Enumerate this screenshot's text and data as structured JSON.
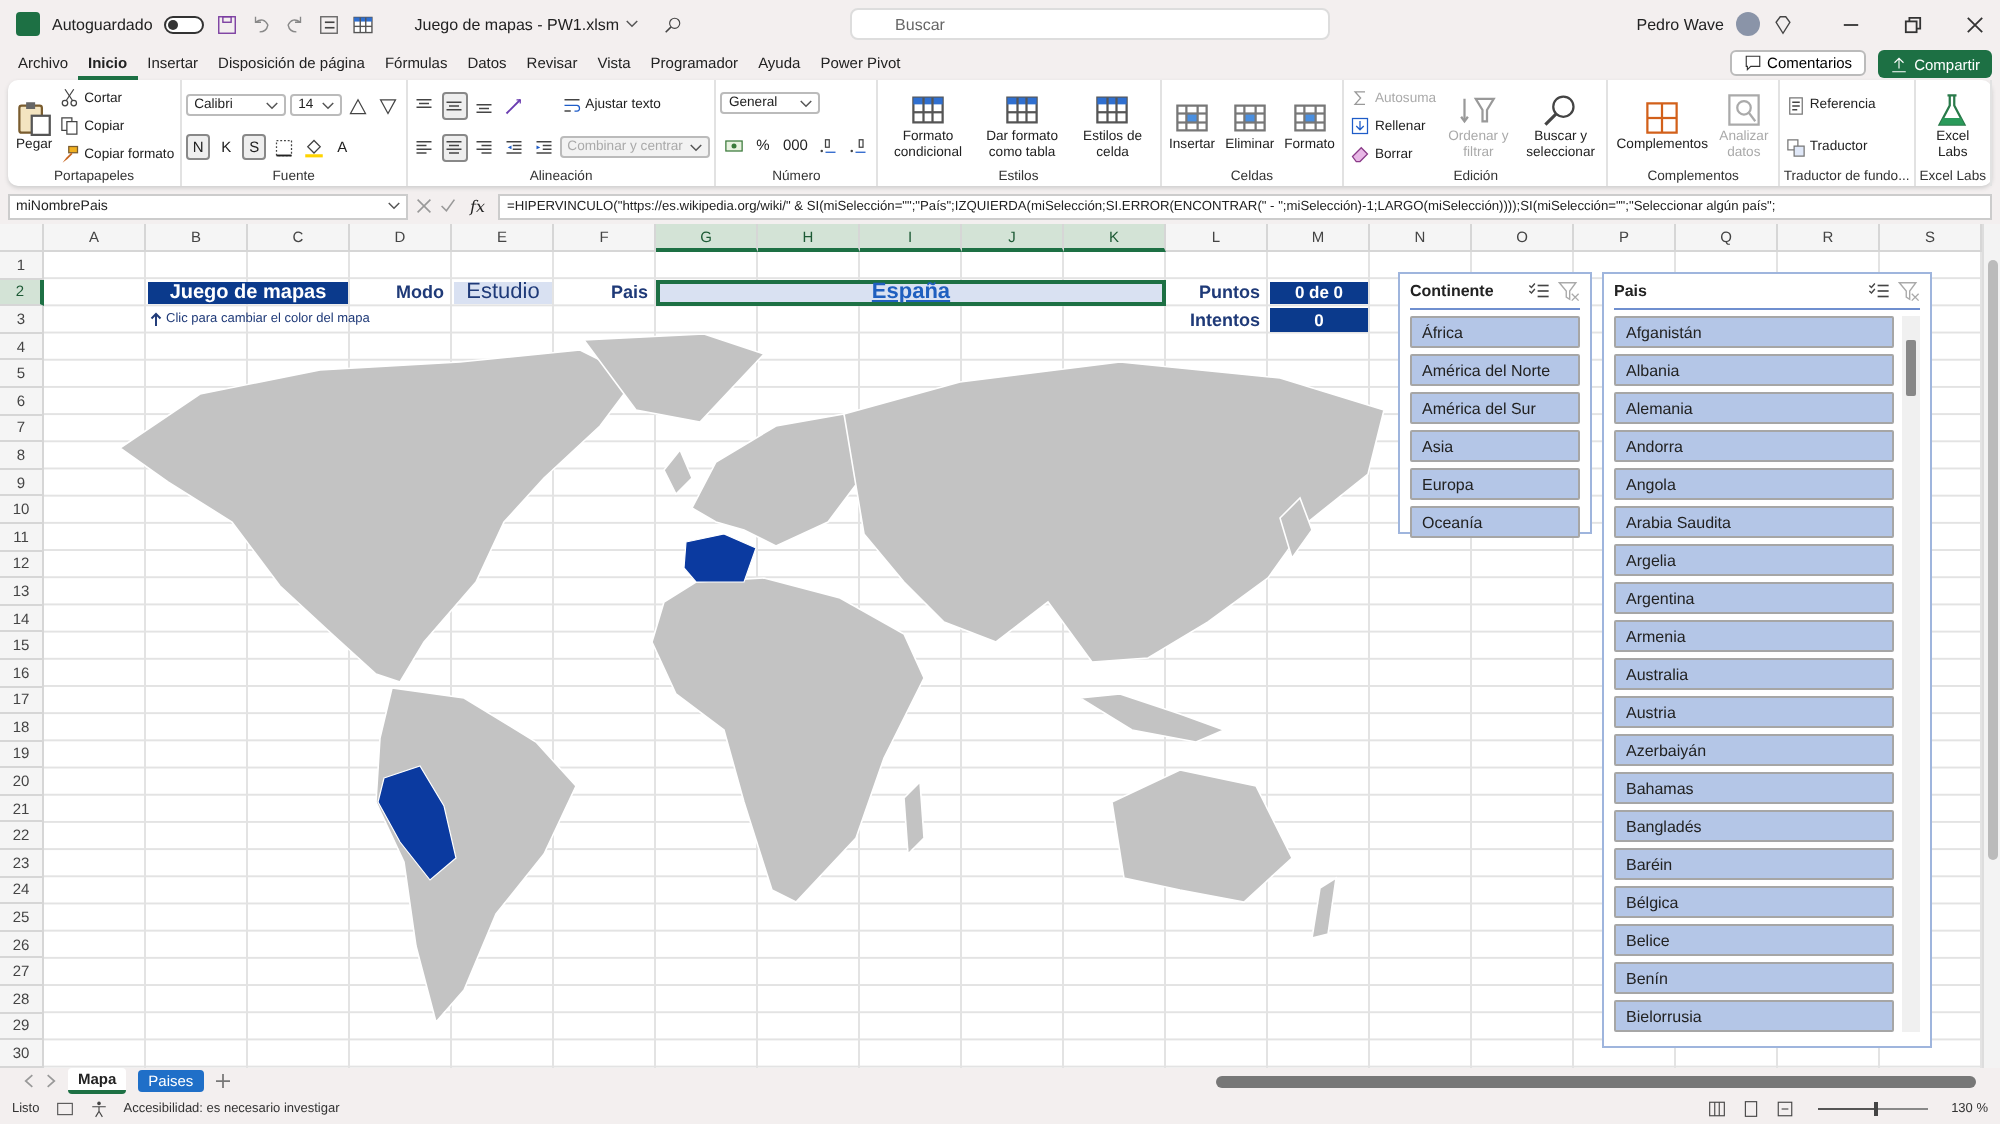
{
  "window": {
    "title": "Juego de mapas - PW1.xlsm",
    "search_placeholder": "Buscar",
    "user": "Pedro Wave"
  },
  "autosave": {
    "label": "Autoguardado",
    "on": false
  },
  "ribbon_tabs": [
    {
      "label": "Archivo",
      "selected": false
    },
    {
      "label": "Inicio",
      "selected": true
    },
    {
      "label": "Insertar",
      "selected": false
    },
    {
      "label": "Disposición de página",
      "selected": false
    },
    {
      "label": "Fórmulas",
      "selected": false
    },
    {
      "label": "Datos",
      "selected": false
    },
    {
      "label": "Revisar",
      "selected": false
    },
    {
      "label": "Vista",
      "selected": false
    },
    {
      "label": "Programador",
      "selected": false
    },
    {
      "label": "Ayuda",
      "selected": false
    },
    {
      "label": "Power Pivot",
      "selected": false
    }
  ],
  "header_buttons": {
    "comments": "Comentarios",
    "share": "Compartir"
  },
  "ribbon_groups": [
    {
      "label": "Portapapeles",
      "columns": [
        [
          [
            {
              "kind": "large",
              "label": "Pegar",
              "disabled": false
            }
          ]
        ],
        [
          [
            {
              "kind": "small",
              "label": "Cortar",
              "disabled": false
            }
          ],
          [
            {
              "kind": "small",
              "label": "Copiar",
              "disabled": false
            }
          ],
          [
            {
              "kind": "small",
              "label": "Copiar formato",
              "disabled": false
            }
          ]
        ]
      ]
    },
    {
      "label": "Fuente",
      "columns": [
        [
          [
            {
              "kind": "combo",
              "label": "Calibri",
              "disabled": false
            },
            {
              "kind": "combo",
              "label": "14",
              "disabled": false
            },
            {
              "kind": "icon",
              "on": false
            },
            {
              "kind": "icon",
              "on": false
            }
          ],
          [
            {
              "kind": "glyph",
              "label": "N",
              "on": true
            },
            {
              "kind": "glyph",
              "label": "K",
              "on": false
            },
            {
              "kind": "glyph",
              "label": "S",
              "on": true
            },
            {
              "kind": "icon",
              "on": false
            },
            {
              "kind": "icon",
              "on": false
            },
            {
              "kind": "glyph",
              "label": "A",
              "on": false
            }
          ]
        ]
      ]
    },
    {
      "label": "Alineación",
      "columns": [
        [
          [
            {
              "kind": "icon",
              "on": false
            },
            {
              "kind": "icon",
              "on": true
            },
            {
              "kind": "icon",
              "on": false
            },
            {
              "kind": "icon",
              "on": false
            }
          ],
          [
            {
              "kind": "icon",
              "on": false
            },
            {
              "kind": "icon",
              "on": true
            },
            {
              "kind": "icon",
              "on": false
            },
            {
              "kind": "icon",
              "on": false
            },
            {
              "kind": "icon",
              "on": false
            }
          ]
        ],
        [
          [
            {
              "kind": "small",
              "label": "Ajustar texto",
              "disabled": false
            }
          ],
          [
            {
              "kind": "combo",
              "label": "Combinar y centrar",
              "disabled": true
            }
          ]
        ]
      ]
    },
    {
      "label": "Número",
      "columns": [
        [
          [
            {
              "kind": "combo",
              "label": "General",
              "disabled": false
            }
          ],
          [
            {
              "kind": "icon",
              "on": false
            },
            {
              "kind": "glyph",
              "label": "%",
              "on": false
            },
            {
              "kind": "glyph",
              "label": "000",
              "on": false
            },
            {
              "kind": "icon",
              "on": false
            },
            {
              "kind": "icon",
              "on": false
            }
          ]
        ]
      ]
    },
    {
      "label": "Estilos",
      "columns": [
        [
          [
            {
              "kind": "large",
              "label": "Formato condicional",
              "disabled": false
            }
          ]
        ],
        [
          [
            {
              "kind": "large",
              "label": "Dar formato como tabla",
              "disabled": false
            }
          ]
        ],
        [
          [
            {
              "kind": "large",
              "label": "Estilos de celda",
              "disabled": false
            }
          ]
        ]
      ]
    },
    {
      "label": "Celdas",
      "columns": [
        [
          [
            {
              "kind": "large",
              "label": "Insertar",
              "disabled": false
            }
          ]
        ],
        [
          [
            {
              "kind": "large",
              "label": "Eliminar",
              "disabled": false
            }
          ]
        ],
        [
          [
            {
              "kind": "large",
              "label": "Formato",
              "disabled": false
            }
          ]
        ]
      ]
    },
    {
      "label": "Edición",
      "columns": [
        [
          [
            {
              "kind": "small",
              "label": "Autosuma",
              "disabled": true
            }
          ],
          [
            {
              "kind": "small",
              "label": "Rellenar",
              "disabled": false
            }
          ],
          [
            {
              "kind": "small",
              "label": "Borrar",
              "disabled": false
            }
          ]
        ],
        [
          [
            {
              "kind": "large",
              "label": "Ordenar y filtrar",
              "disabled": true
            }
          ]
        ],
        [
          [
            {
              "kind": "large",
              "label": "Buscar y seleccionar",
              "disabled": false
            }
          ]
        ]
      ]
    },
    {
      "label": "Complementos",
      "columns": [
        [
          [
            {
              "kind": "large",
              "label": "Complementos",
              "disabled": false
            }
          ]
        ],
        [
          [
            {
              "kind": "large",
              "label": "Analizar datos",
              "disabled": true
            }
          ]
        ]
      ]
    },
    {
      "label": "Traductor de fundo...",
      "columns": [
        [
          [
            {
              "kind": "small",
              "label": "Referencia",
              "disabled": false
            }
          ],
          [
            {
              "kind": "small",
              "label": "Traductor",
              "disabled": false
            }
          ]
        ]
      ]
    },
    {
      "label": "Excel Labs",
      "columns": [
        [
          [
            {
              "kind": "large",
              "label": "Excel Labs",
              "disabled": false
            }
          ]
        ]
      ]
    }
  ],
  "formula_bar": {
    "name_box": "miNombrePais",
    "function_label": "fx",
    "formula": "=HIPERVINCULO(\"https://es.wikipedia.org/wiki/\" & SI(miSelección=\"\";\"País\";IZQUIERDA(miSelección;SI.ERROR(ENCONTRAR(\" - \";miSelección)-1;LARGO(miSelección))));SI(miSelección=\"\";\"Seleccionar algún país\";"
  },
  "columns": [
    {
      "label": "A",
      "selected": false
    },
    {
      "label": "B",
      "selected": false
    },
    {
      "label": "C",
      "selected": false
    },
    {
      "label": "D",
      "selected": false
    },
    {
      "label": "E",
      "selected": false
    },
    {
      "label": "F",
      "selected": false
    },
    {
      "label": "G",
      "selected": true
    },
    {
      "label": "H",
      "selected": true
    },
    {
      "label": "I",
      "selected": true
    },
    {
      "label": "J",
      "selected": true
    },
    {
      "label": "K",
      "selected": true
    },
    {
      "label": "L",
      "selected": false
    },
    {
      "label": "M",
      "selected": false
    },
    {
      "label": "N",
      "selected": false
    },
    {
      "label": "O",
      "selected": false
    },
    {
      "label": "P",
      "selected": false
    },
    {
      "label": "Q",
      "selected": false
    },
    {
      "label": "R",
      "selected": false
    },
    {
      "label": "S",
      "selected": false
    }
  ],
  "rows": [
    {
      "label": "1",
      "selected": false
    },
    {
      "label": "2",
      "selected": true
    },
    {
      "label": "3",
      "selected": false
    },
    {
      "label": "4",
      "selected": false
    },
    {
      "label": "5",
      "selected": false
    },
    {
      "label": "6",
      "selected": false
    },
    {
      "label": "7",
      "selected": false
    },
    {
      "label": "8",
      "selected": false
    },
    {
      "label": "9",
      "selected": false
    },
    {
      "label": "10",
      "selected": false
    },
    {
      "label": "11",
      "selected": false
    },
    {
      "label": "12",
      "selected": false
    },
    {
      "label": "13",
      "selected": false
    },
    {
      "label": "14",
      "selected": false
    },
    {
      "label": "15",
      "selected": false
    },
    {
      "label": "16",
      "selected": false
    },
    {
      "label": "17",
      "selected": false
    },
    {
      "label": "18",
      "selected": false
    },
    {
      "label": "19",
      "selected": false
    },
    {
      "label": "20",
      "selected": false
    },
    {
      "label": "21",
      "selected": false
    },
    {
      "label": "22",
      "selected": false
    },
    {
      "label": "23",
      "selected": false
    },
    {
      "label": "24",
      "selected": false
    },
    {
      "label": "25",
      "selected": false
    },
    {
      "label": "26",
      "selected": false
    },
    {
      "label": "27",
      "selected": false
    },
    {
      "label": "28",
      "selected": false
    },
    {
      "label": "29",
      "selected": false
    },
    {
      "label": "30",
      "selected": false
    }
  ],
  "sheet": {
    "title_cell": "Juego de mapas",
    "hint": "Clic para cambiar el color del mapa",
    "mode_label": "Modo",
    "mode_value": "Estudio",
    "country_label": "Pais",
    "country_value": "España",
    "points_label": "Puntos",
    "points_value": "0 de 0",
    "attempts_label": "Intentos",
    "attempts_value": "0"
  },
  "slicers": [
    {
      "title": "Continente",
      "items": [
        {
          "label": "África",
          "selected": true
        },
        {
          "label": "América del Norte",
          "selected": true
        },
        {
          "label": "América del Sur",
          "selected": true
        },
        {
          "label": "Asia",
          "selected": true
        },
        {
          "label": "Europa",
          "selected": true
        },
        {
          "label": "Oceanía",
          "selected": true
        }
      ]
    },
    {
      "title": "Pais",
      "items": [
        {
          "label": "Afganistán",
          "selected": true
        },
        {
          "label": "Albania",
          "selected": true
        },
        {
          "label": "Alemania",
          "selected": true
        },
        {
          "label": "Andorra",
          "selected": true
        },
        {
          "label": "Angola",
          "selected": true
        },
        {
          "label": "Arabia Saudita",
          "selected": true
        },
        {
          "label": "Argelia",
          "selected": true
        },
        {
          "label": "Argentina",
          "selected": true
        },
        {
          "label": "Armenia",
          "selected": true
        },
        {
          "label": "Australia",
          "selected": true
        },
        {
          "label": "Austria",
          "selected": true
        },
        {
          "label": "Azerbaiyán",
          "selected": true
        },
        {
          "label": "Bahamas",
          "selected": true
        },
        {
          "label": "Bangladés",
          "selected": true
        },
        {
          "label": "Baréin",
          "selected": true
        },
        {
          "label": "Bélgica",
          "selected": true
        },
        {
          "label": "Belice",
          "selected": true
        },
        {
          "label": "Benín",
          "selected": true
        },
        {
          "label": "Bielorrusia",
          "selected": true
        }
      ]
    }
  ],
  "sheet_tabs": [
    {
      "label": "Mapa",
      "selected": true
    },
    {
      "label": "Paises",
      "selected": false,
      "color": "#1f6fc8"
    }
  ],
  "status_bar": {
    "ready": "Listo",
    "accessibility": "Accesibilidad: es necesario investigar",
    "zoom": "130 %",
    "zoom_slider": {
      "level": 0.55
    }
  }
}
